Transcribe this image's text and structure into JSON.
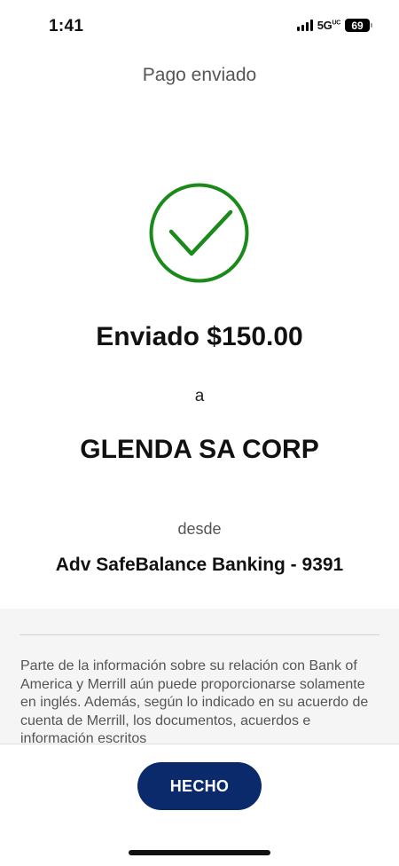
{
  "status_bar": {
    "time": "1:41",
    "network": "5G",
    "network_sub": "UC",
    "battery": "69",
    "icons": [
      "signal-bars-icon",
      "battery-icon"
    ]
  },
  "header": {
    "title": "Pago enviado"
  },
  "confirmation": {
    "icon": "checkmark-circle-icon",
    "icon_color": "#1a8a1a",
    "sent_amount": "Enviado $150.00",
    "to_label": "a",
    "recipient": "GLENDA SA CORP",
    "from_label": "desde",
    "account": "Adv SafeBalance Banking - 9391"
  },
  "disclaimer": {
    "text": "Parte de la información sobre su relación con Bank of America y Merrill aún puede proporcionarse solamente en inglés. Además, según lo indicado en su acuerdo de cuenta de Merrill, los documentos, acuerdos e información escritos"
  },
  "footer": {
    "done_label": "HECHO",
    "accent_color": "#0a2a6b"
  }
}
